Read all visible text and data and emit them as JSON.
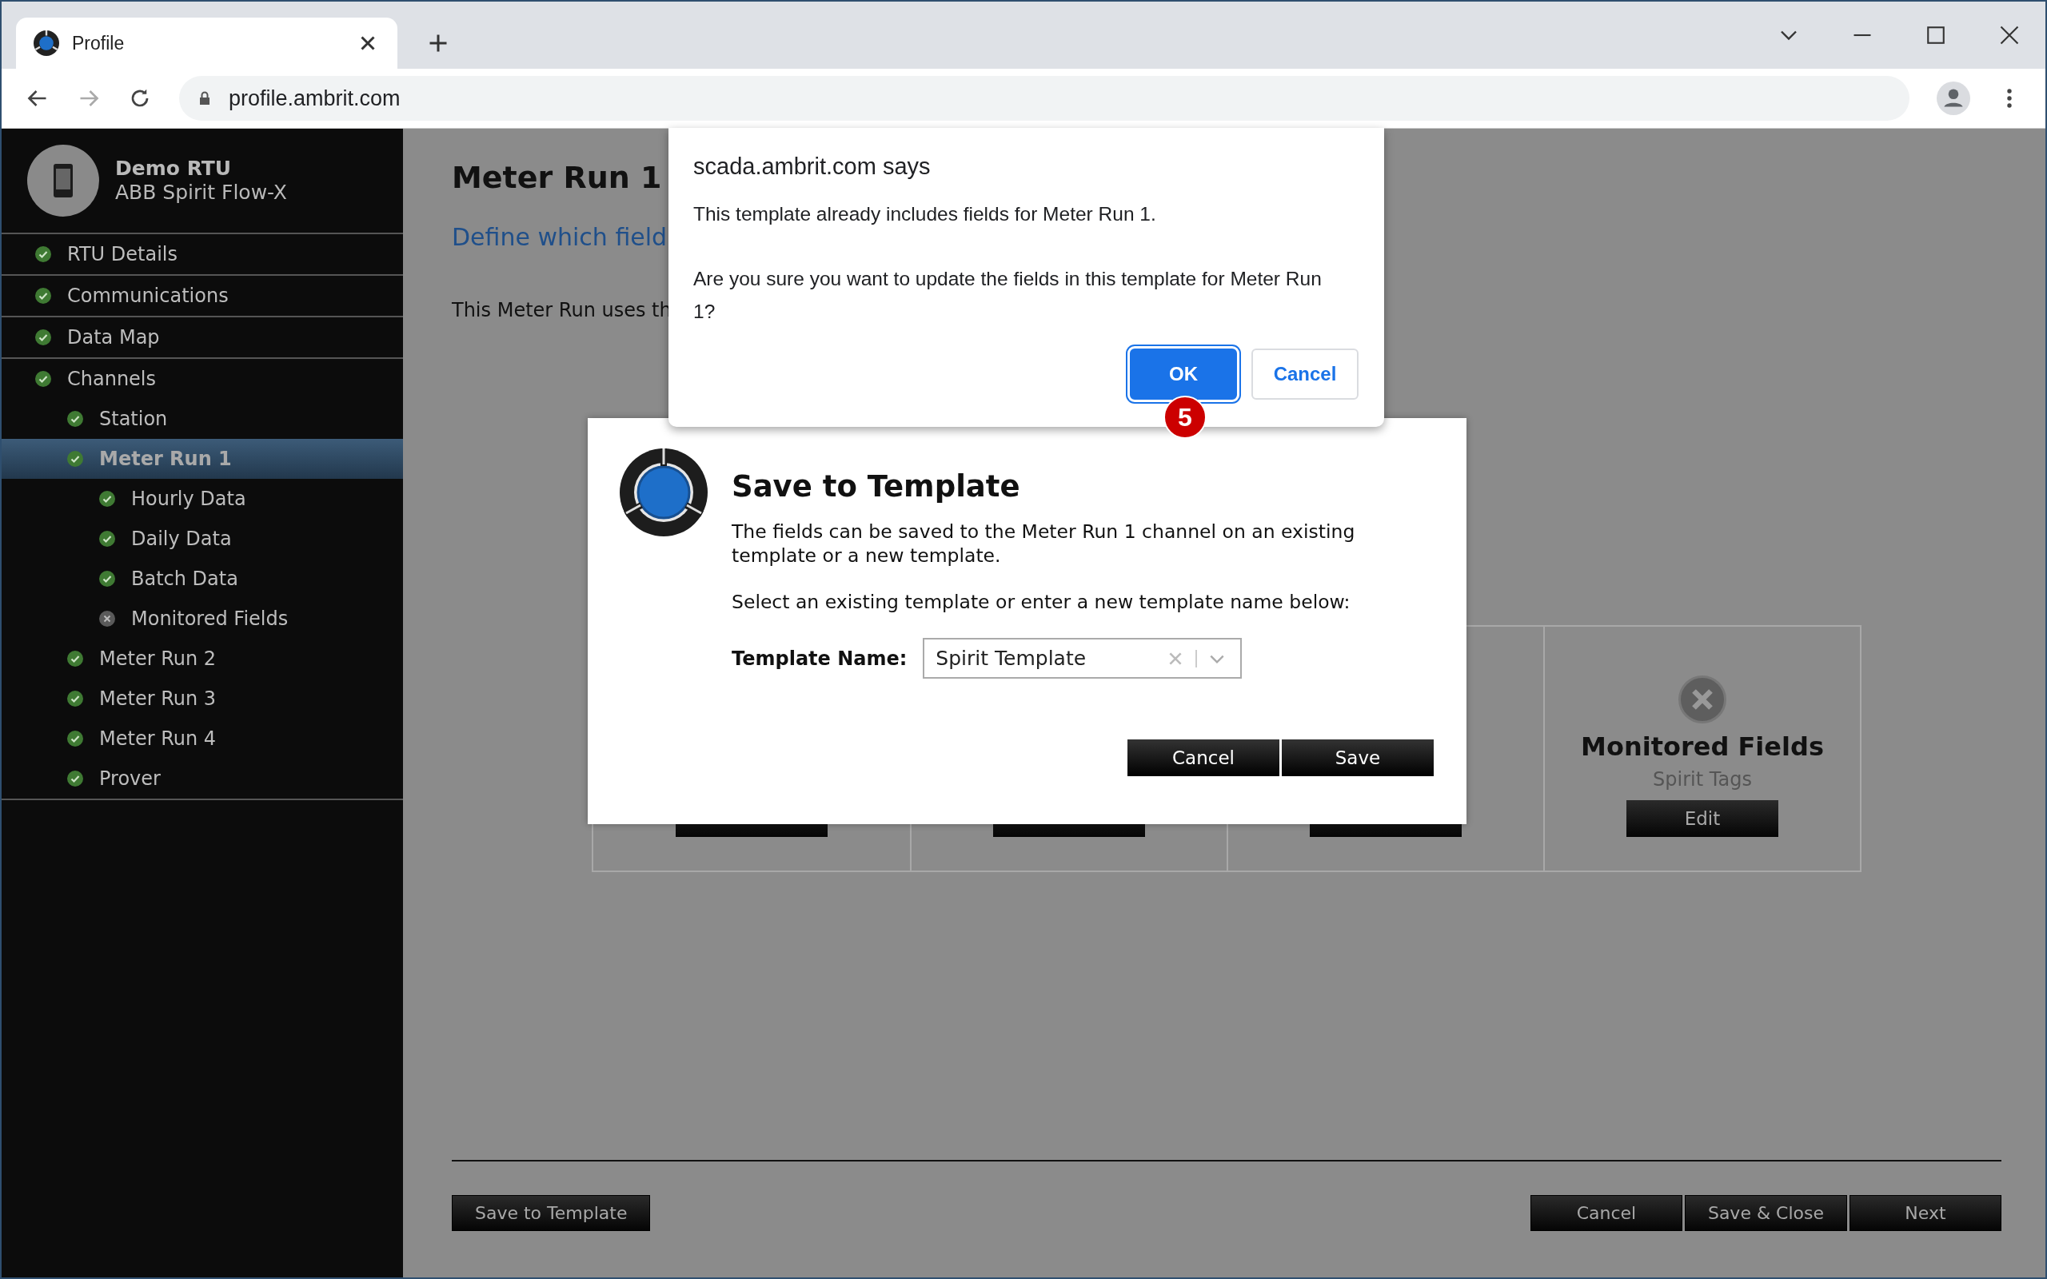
{
  "browser": {
    "tab_title": "Profile",
    "url": "profile.ambrit.com"
  },
  "device": {
    "name": "Demo RTU",
    "model": "ABB Spirit Flow-X"
  },
  "nav": [
    {
      "label": "RTU Details",
      "complete": true,
      "selected": false
    },
    {
      "label": "Communications",
      "complete": true,
      "selected": false
    },
    {
      "label": "Data Map",
      "complete": true,
      "selected": false
    },
    {
      "label": "Channels",
      "complete": true,
      "selected": false,
      "children": [
        {
          "label": "Station",
          "complete": true,
          "selected": false
        },
        {
          "label": "Meter Run 1",
          "complete": true,
          "selected": true,
          "children": [
            {
              "label": "Hourly Data",
              "complete": true,
              "selected": false
            },
            {
              "label": "Daily Data",
              "complete": true,
              "selected": false
            },
            {
              "label": "Batch Data",
              "complete": true,
              "selected": false
            },
            {
              "label": "Monitored Fields",
              "complete": false,
              "selected": false
            }
          ]
        },
        {
          "label": "Meter Run 2",
          "complete": true,
          "selected": false
        },
        {
          "label": "Meter Run 3",
          "complete": true,
          "selected": false
        },
        {
          "label": "Meter Run 4",
          "complete": true,
          "selected": false
        },
        {
          "label": "Prover",
          "complete": true,
          "selected": false
        }
      ]
    }
  ],
  "page": {
    "title": "Meter Run 1",
    "subtitle": "Define which field",
    "intro": "This Meter Run uses th"
  },
  "cards": [
    {
      "kind": "covered"
    },
    {
      "kind": "covered"
    },
    {
      "kind": "covered"
    },
    {
      "kind": "step",
      "title": "Monitored Fields",
      "subtitle": "Spirit Tags",
      "complete": false,
      "button": "Edit"
    }
  ],
  "footer": {
    "left_buttons": [
      "Save to Template"
    ],
    "right_buttons": [
      "Cancel",
      "Save & Close",
      "Next"
    ]
  },
  "modal": {
    "title": "Save to Template",
    "paragraphs": [
      "The fields can be saved to the Meter Run 1 channel on an existing template or a new template.",
      "Select an existing template or enter a new template name below:"
    ],
    "field_label": "Template Name:",
    "value": "Spirit Template",
    "buttons": [
      "Cancel",
      "Save"
    ]
  },
  "alert": {
    "origin": "scada.ambrit.com says",
    "lines": [
      "This template already includes fields for Meter Run 1.",
      "Are you sure you want to update the fields in this template for Meter Run 1?"
    ],
    "buttons": [
      {
        "label": "OK",
        "focused": true
      },
      {
        "label": "Cancel",
        "focused": false
      }
    ],
    "callout": "5"
  }
}
